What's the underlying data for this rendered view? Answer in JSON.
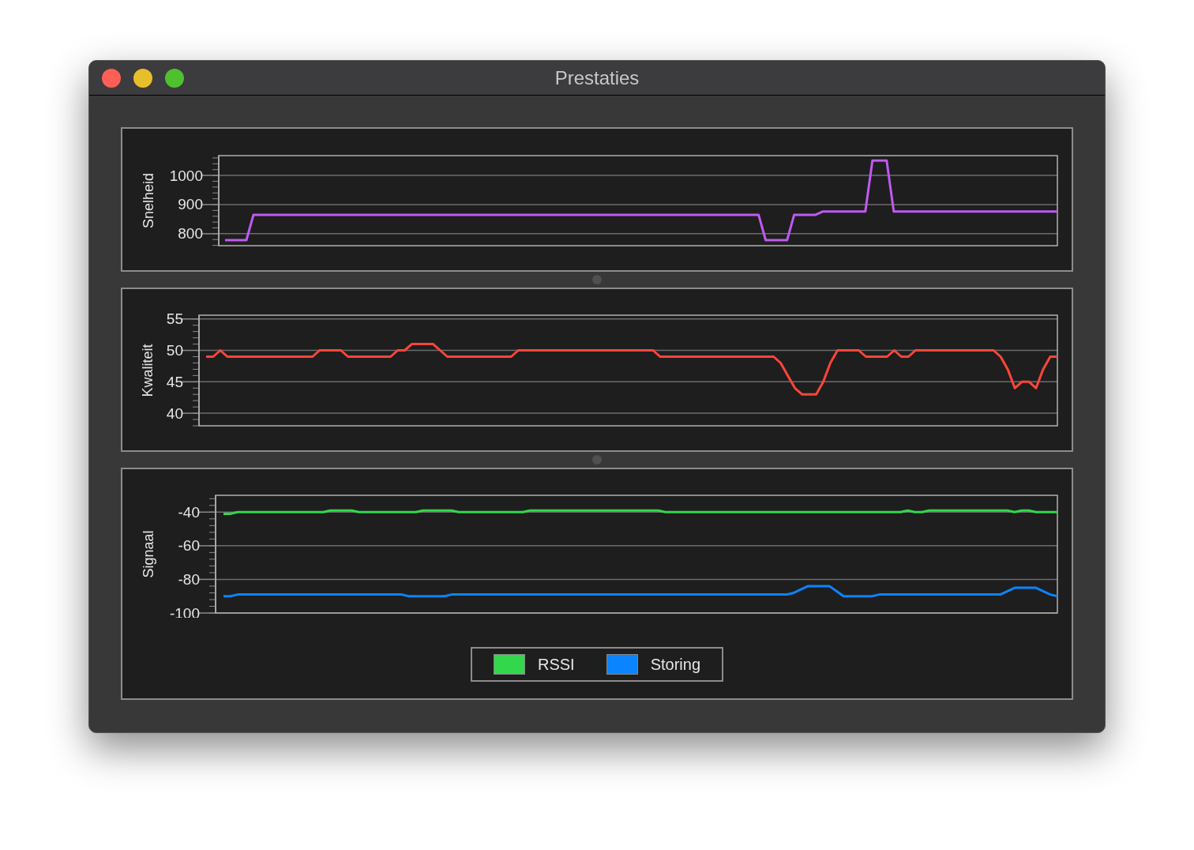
{
  "window": {
    "title": "Prestaties"
  },
  "charts": [
    {
      "chart_data": {
        "type": "line",
        "ylabel": "Snelheid",
        "grid": true,
        "ylim": [
          759,
          1068
        ],
        "yticks": [
          800,
          900,
          1000
        ],
        "categories": [
          null,
          null,
          null,
          null,
          null,
          null,
          null,
          null,
          null,
          null,
          null,
          null,
          null,
          null,
          null,
          null,
          null,
          null,
          null,
          null,
          null,
          null,
          null,
          null,
          null,
          null,
          null,
          null,
          null,
          null,
          null,
          null,
          null,
          null,
          null,
          null,
          null,
          null,
          null,
          null,
          null,
          null,
          null,
          null,
          null,
          null,
          null,
          null,
          null,
          null,
          null,
          null,
          null,
          null,
          null,
          null,
          null,
          null,
          null,
          null,
          null,
          null,
          null,
          null,
          null,
          null,
          null,
          null,
          null,
          null,
          null,
          null,
          null,
          null,
          null,
          null,
          null,
          null,
          null,
          null,
          null,
          null,
          null,
          null,
          null,
          null,
          null,
          null,
          null,
          null,
          null,
          null,
          null,
          null,
          null,
          null,
          null,
          null,
          null,
          null,
          null,
          null,
          null,
          null,
          null,
          null,
          null,
          null,
          null,
          null,
          null,
          null,
          null,
          null,
          null,
          null,
          null,
          null
        ],
        "series": [
          {
            "color": "#bf5af2",
            "values": [
              778,
              778,
              778,
              778,
              865,
              865,
              865,
              865,
              865,
              865,
              865,
              865,
              865,
              865,
              865,
              865,
              865,
              865,
              865,
              865,
              865,
              865,
              865,
              865,
              865,
              865,
              865,
              865,
              865,
              865,
              865,
              865,
              865,
              865,
              865,
              865,
              865,
              865,
              865,
              865,
              865,
              865,
              865,
              865,
              865,
              865,
              865,
              865,
              865,
              865,
              865,
              865,
              865,
              865,
              865,
              865,
              865,
              865,
              865,
              865,
              865,
              865,
              865,
              865,
              865,
              865,
              865,
              865,
              865,
              865,
              865,
              865,
              865,
              865,
              865,
              865,
              778,
              778,
              778,
              778,
              865,
              865,
              865,
              865,
              876,
              876,
              876,
              876,
              876,
              876,
              876,
              1051,
              1051,
              1051,
              876,
              876,
              876,
              876,
              876,
              876,
              876,
              876,
              876,
              876,
              876,
              876,
              876,
              876,
              876,
              876,
              876,
              876,
              876,
              876,
              876,
              876,
              876,
              876
            ]
          }
        ]
      }
    },
    {
      "chart_data": {
        "type": "line",
        "ylabel": "Kwaliteit",
        "grid": true,
        "ylim": [
          38,
          55.6
        ],
        "yticks": [
          40,
          45,
          50,
          55
        ],
        "categories": [
          null,
          null,
          null,
          null,
          null,
          null,
          null,
          null,
          null,
          null,
          null,
          null,
          null,
          null,
          null,
          null,
          null,
          null,
          null,
          null,
          null,
          null,
          null,
          null,
          null,
          null,
          null,
          null,
          null,
          null,
          null,
          null,
          null,
          null,
          null,
          null,
          null,
          null,
          null,
          null,
          null,
          null,
          null,
          null,
          null,
          null,
          null,
          null,
          null,
          null,
          null,
          null,
          null,
          null,
          null,
          null,
          null,
          null,
          null,
          null,
          null,
          null,
          null,
          null,
          null,
          null,
          null,
          null,
          null,
          null,
          null,
          null,
          null,
          null,
          null,
          null,
          null,
          null,
          null,
          null,
          null,
          null,
          null,
          null,
          null,
          null,
          null,
          null,
          null,
          null,
          null,
          null,
          null,
          null,
          null,
          null,
          null,
          null,
          null,
          null,
          null,
          null,
          null,
          null,
          null,
          null,
          null,
          null,
          null,
          null,
          null,
          null,
          null,
          null,
          null,
          null,
          null,
          null,
          null,
          null,
          null
        ],
        "series": [
          {
            "color": "#ff453a",
            "values": [
              49,
              49,
              50,
              49,
              49,
              49,
              49,
              49,
              49,
              49,
              49,
              49,
              49,
              49,
              49,
              49,
              50,
              50,
              50,
              50,
              49,
              49,
              49,
              49,
              49,
              49,
              49,
              50,
              50,
              51,
              51,
              51,
              51,
              50,
              49,
              49,
              49,
              49,
              49,
              49,
              49,
              49,
              49,
              49,
              50,
              50,
              50,
              50,
              50,
              50,
              50,
              50,
              50,
              50,
              50,
              50,
              50,
              50,
              50,
              50,
              50,
              50,
              50,
              50,
              49,
              49,
              49,
              49,
              49,
              49,
              49,
              49,
              49,
              49,
              49,
              49,
              49,
              49,
              49,
              49,
              49,
              48,
              46,
              44,
              43,
              43,
              43,
              45,
              48,
              50,
              50,
              50,
              50,
              49,
              49,
              49,
              49,
              50,
              49,
              49,
              50,
              50,
              50,
              50,
              50,
              50,
              50,
              50,
              50,
              50,
              50,
              50,
              49,
              47,
              44,
              45,
              45,
              44,
              47,
              49,
              49
            ]
          }
        ]
      }
    },
    {
      "chart_data": {
        "type": "line",
        "ylabel": "Signaal",
        "grid": true,
        "legend": "bottom",
        "ylim": [
          -100,
          -30
        ],
        "yticks": [
          -100,
          -80,
          -60,
          -40
        ],
        "categories": [
          null,
          null,
          null,
          null,
          null,
          null,
          null,
          null,
          null,
          null,
          null,
          null,
          null,
          null,
          null,
          null,
          null,
          null,
          null,
          null,
          null,
          null,
          null,
          null,
          null,
          null,
          null,
          null,
          null,
          null,
          null,
          null,
          null,
          null,
          null,
          null,
          null,
          null,
          null,
          null,
          null,
          null,
          null,
          null,
          null,
          null,
          null,
          null,
          null,
          null,
          null,
          null,
          null,
          null,
          null,
          null,
          null,
          null,
          null,
          null,
          null,
          null,
          null,
          null,
          null,
          null,
          null,
          null,
          null,
          null,
          null,
          null,
          null,
          null,
          null,
          null,
          null,
          null,
          null,
          null,
          null,
          null,
          null,
          null,
          null,
          null,
          null,
          null,
          null,
          null,
          null,
          null,
          null,
          null,
          null,
          null,
          null,
          null,
          null,
          null,
          null,
          null,
          null,
          null,
          null,
          null,
          null,
          null,
          null,
          null,
          null,
          null,
          null,
          null,
          null,
          null,
          null,
          null
        ],
        "series": [
          {
            "name": "RSSI",
            "color": "#32d74b",
            "values": [
              -41,
              -41,
              -40,
              -40,
              -40,
              -40,
              -40,
              -40,
              -40,
              -40,
              -40,
              -40,
              -40,
              -40,
              -40,
              -39,
              -39,
              -39,
              -39,
              -40,
              -40,
              -40,
              -40,
              -40,
              -40,
              -40,
              -40,
              -40,
              -39,
              -39,
              -39,
              -39,
              -39,
              -40,
              -40,
              -40,
              -40,
              -40,
              -40,
              -40,
              -40,
              -40,
              -40,
              -39,
              -39,
              -39,
              -39,
              -39,
              -39,
              -39,
              -39,
              -39,
              -39,
              -39,
              -39,
              -39,
              -39,
              -39,
              -39,
              -39,
              -39,
              -39,
              -40,
              -40,
              -40,
              -40,
              -40,
              -40,
              -40,
              -40,
              -40,
              -40,
              -40,
              -40,
              -40,
              -40,
              -40,
              -40,
              -40,
              -40,
              -40,
              -40,
              -40,
              -40,
              -40,
              -40,
              -40,
              -40,
              -40,
              -40,
              -40,
              -40,
              -40,
              -40,
              -40,
              -40,
              -39,
              -40,
              -40,
              -39,
              -39,
              -39,
              -39,
              -39,
              -39,
              -39,
              -39,
              -39,
              -39,
              -39,
              -39,
              -40,
              -39,
              -39,
              -40,
              -40,
              -40,
              -40
            ]
          },
          {
            "name": "Storing",
            "color": "#0a84ff",
            "values": [
              -90,
              -90,
              -89,
              -89,
              -89,
              -89,
              -89,
              -89,
              -89,
              -89,
              -89,
              -89,
              -89,
              -89,
              -89,
              -89,
              -89,
              -89,
              -89,
              -89,
              -89,
              -89,
              -89,
              -89,
              -89,
              -89,
              -90,
              -90,
              -90,
              -90,
              -90,
              -90,
              -89,
              -89,
              -89,
              -89,
              -89,
              -89,
              -89,
              -89,
              -89,
              -89,
              -89,
              -89,
              -89,
              -89,
              -89,
              -89,
              -89,
              -89,
              -89,
              -89,
              -89,
              -89,
              -89,
              -89,
              -89,
              -89,
              -89,
              -89,
              -89,
              -89,
              -89,
              -89,
              -89,
              -89,
              -89,
              -89,
              -89,
              -89,
              -89,
              -89,
              -89,
              -89,
              -89,
              -89,
              -89,
              -89,
              -89,
              -89,
              -88,
              -86,
              -84,
              -84,
              -84,
              -84,
              -87,
              -90,
              -90,
              -90,
              -90,
              -90,
              -89,
              -89,
              -89,
              -89,
              -89,
              -89,
              -89,
              -89,
              -89,
              -89,
              -89,
              -89,
              -89,
              -89,
              -89,
              -89,
              -89,
              -89,
              -87,
              -85,
              -85,
              -85,
              -85,
              -87,
              -89,
              -90
            ]
          }
        ]
      }
    }
  ]
}
